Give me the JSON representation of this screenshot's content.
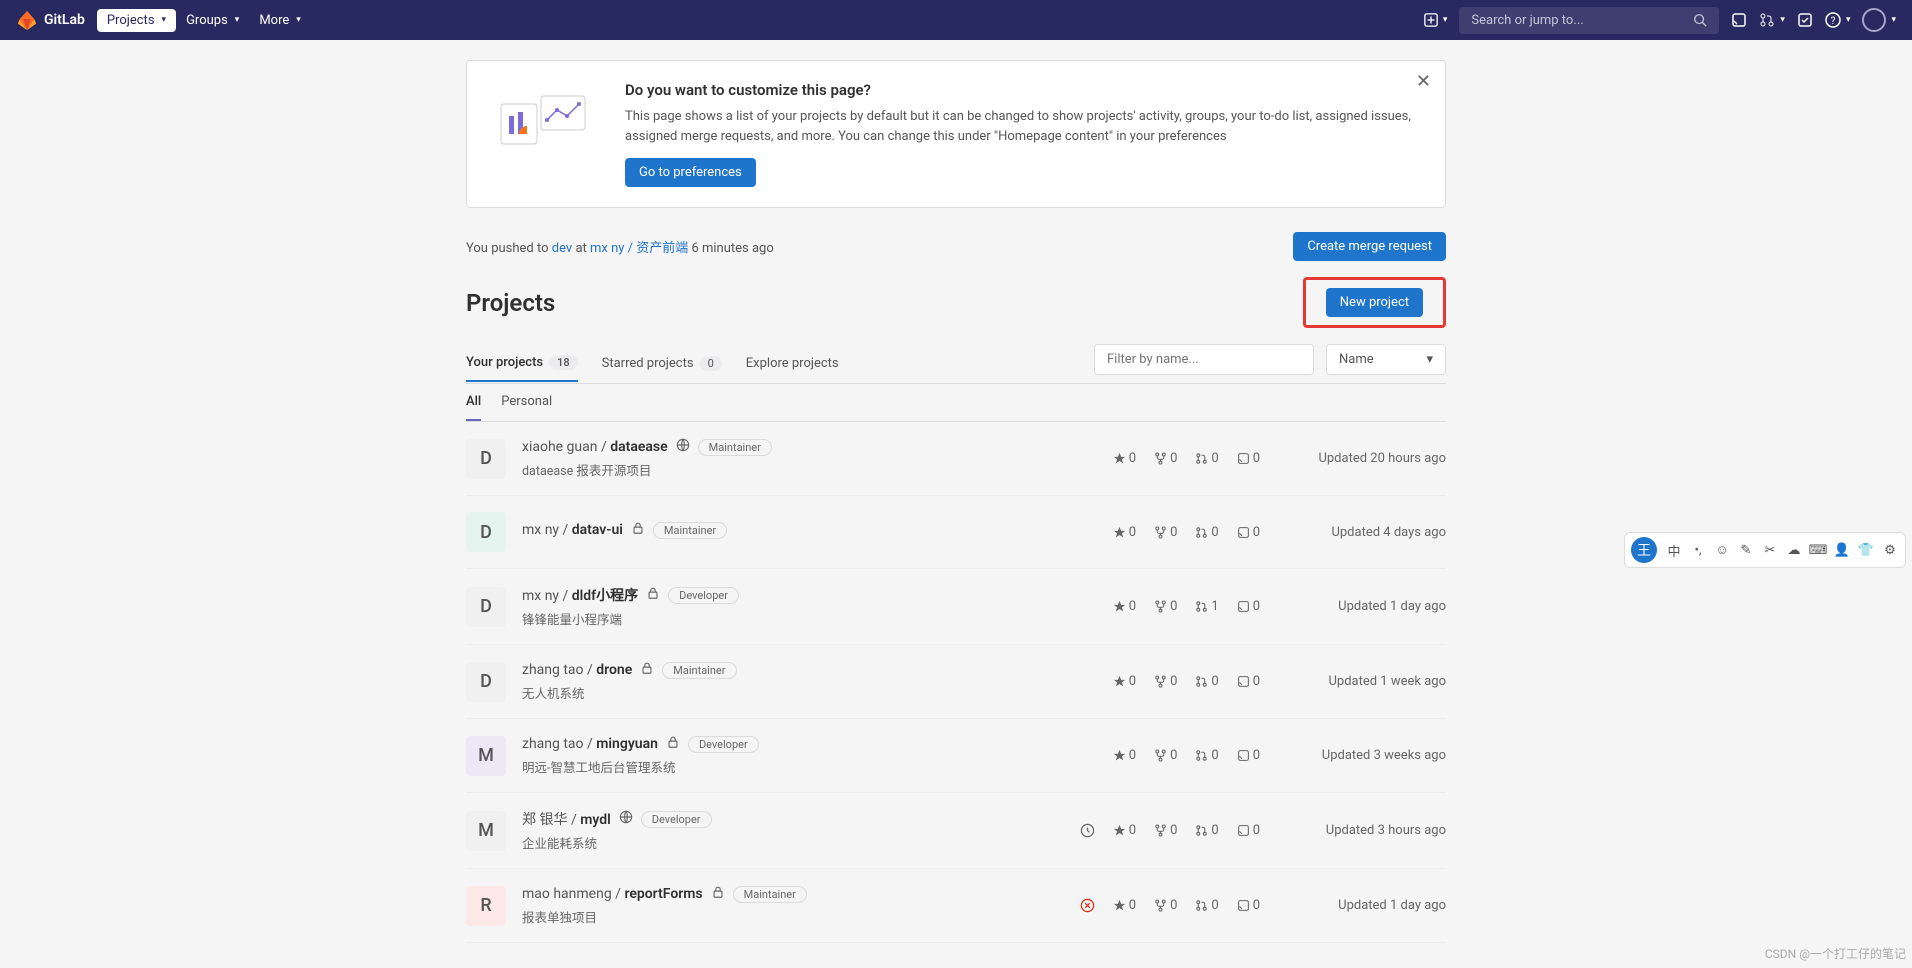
{
  "brand": "GitLab",
  "nav": {
    "projects": "Projects",
    "groups": "Groups",
    "more": "More"
  },
  "search": {
    "placeholder": "Search or jump to..."
  },
  "banner": {
    "title": "Do you want to customize this page?",
    "body": "This page shows a list of your projects by default but it can be changed to show projects' activity, groups, your to-do list, assigned issues, assigned merge requests, and more. You can change this under \"Homepage content\" in your preferences",
    "button": "Go to preferences"
  },
  "push": {
    "prefix": "You pushed to ",
    "branch": "dev",
    "at": " at ",
    "group": "mx ny / ",
    "repo": "资产前端",
    "time": " 6 minutes ago",
    "merge_btn": "Create merge request"
  },
  "heading": "Projects",
  "new_project_btn": "New project",
  "tabs": {
    "your": "Your projects",
    "your_count": "18",
    "starred": "Starred projects",
    "starred_count": "0",
    "explore": "Explore projects"
  },
  "filter_placeholder": "Filter by name...",
  "sort_label": "Name",
  "subtabs": {
    "all": "All",
    "personal": "Personal"
  },
  "updated_prefix": "Updated ",
  "projects": [
    {
      "avatar": "D",
      "avbg": "#f0f0f0",
      "ns": "xiaohe guan / ",
      "name": "dataease",
      "vis": "public",
      "role": "Maintainer",
      "desc": "dataease 报表开源项目",
      "stars": "0",
      "forks": "0",
      "mrs": "0",
      "issues": "0",
      "updated": "20 hours ago"
    },
    {
      "avatar": "D",
      "avbg": "#e6f4ef",
      "ns": "mx ny / ",
      "name": "datav-ui",
      "vis": "private",
      "role": "Maintainer",
      "desc": "",
      "stars": "0",
      "forks": "0",
      "mrs": "0",
      "issues": "0",
      "updated": "4 days ago"
    },
    {
      "avatar": "D",
      "avbg": "#f0f0f0",
      "ns": "mx ny / ",
      "name": "dldf小程序",
      "vis": "private",
      "role": "Developer",
      "desc": "锋锋能量小程序端",
      "stars": "0",
      "forks": "0",
      "mrs": "1",
      "issues": "0",
      "updated": "1 day ago"
    },
    {
      "avatar": "D",
      "avbg": "#f0f0f0",
      "ns": "zhang tao / ",
      "name": "drone",
      "vis": "private",
      "role": "Maintainer",
      "desc": "无人机系统",
      "stars": "0",
      "forks": "0",
      "mrs": "0",
      "issues": "0",
      "updated": "1 week ago"
    },
    {
      "avatar": "M",
      "avbg": "#ece8f5",
      "ns": "zhang tao / ",
      "name": "mingyuan",
      "vis": "private",
      "role": "Developer",
      "desc": "明远-智慧工地后台管理系统",
      "stars": "0",
      "forks": "0",
      "mrs": "0",
      "issues": "0",
      "updated": "3 weeks ago"
    },
    {
      "avatar": "M",
      "avbg": "#f0f0f0",
      "ns": "郑 银华 / ",
      "name": "mydl",
      "vis": "public",
      "role": "Developer",
      "desc": "企业能耗系统",
      "stars": "0",
      "forks": "0",
      "mrs": "0",
      "issues": "0",
      "updated": "3 hours ago",
      "ci": "pending"
    },
    {
      "avatar": "R",
      "avbg": "#fde8e8",
      "ns": "mao hanmeng / ",
      "name": "reportForms",
      "vis": "private",
      "role": "Maintainer",
      "desc": "报表单独项目",
      "stars": "0",
      "forks": "0",
      "mrs": "0",
      "issues": "0",
      "updated": "1 day ago",
      "ci": "failed"
    }
  ],
  "watermark": "CSDN @一个打工仔的笔记"
}
